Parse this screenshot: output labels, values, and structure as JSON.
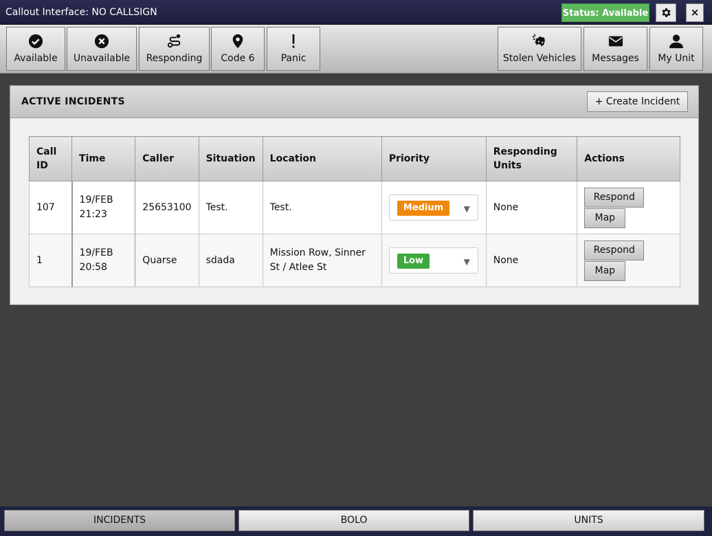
{
  "window": {
    "title": "Callout Interface: NO CALLSIGN",
    "status_label": "Status: Available",
    "status_color": "#5cb85c",
    "close_label": "×"
  },
  "toolbar": {
    "left": [
      {
        "label": "Available",
        "icon": "check-circle-icon"
      },
      {
        "label": "Unavailable",
        "icon": "x-circle-icon"
      },
      {
        "label": "Responding",
        "icon": "route-icon"
      },
      {
        "label": "Code 6",
        "icon": "map-pin-icon"
      },
      {
        "label": "Panic",
        "icon": "exclamation-icon"
      }
    ],
    "right": [
      {
        "label": "Stolen Vehicles",
        "icon": "car-crash-icon"
      },
      {
        "label": "Messages",
        "icon": "envelope-icon"
      },
      {
        "label": "My Unit",
        "icon": "user-icon"
      }
    ]
  },
  "panel": {
    "title": "ACTIVE INCIDENTS",
    "create_label": "+ Create Incident"
  },
  "table": {
    "headers": {
      "call_id": "Call ID",
      "time": "Time",
      "caller": "Caller",
      "situation": "Situation",
      "location": "Location",
      "priority": "Priority",
      "units": "Responding Units",
      "actions": "Actions"
    },
    "rows": [
      {
        "call_id": "107",
        "time": "19/FEB 21:23",
        "caller": "25653100",
        "situation": "Test.",
        "location": "Test.",
        "priority": "Medium",
        "priority_color": "#f0880c",
        "units": "None",
        "respond_label": "Respond",
        "map_label": "Map"
      },
      {
        "call_id": "1",
        "time": "19/FEB 20:58",
        "caller": "Quarse",
        "situation": "sdada",
        "location": "Mission Row, Sinner St / Atlee St",
        "priority": "Low",
        "priority_color": "#3fa93f",
        "units": "None",
        "respond_label": "Respond",
        "map_label": "Map"
      }
    ]
  },
  "tabs": [
    {
      "label": "INCIDENTS",
      "active": true
    },
    {
      "label": "BOLO",
      "active": false
    },
    {
      "label": "UNITS",
      "active": false
    }
  ]
}
